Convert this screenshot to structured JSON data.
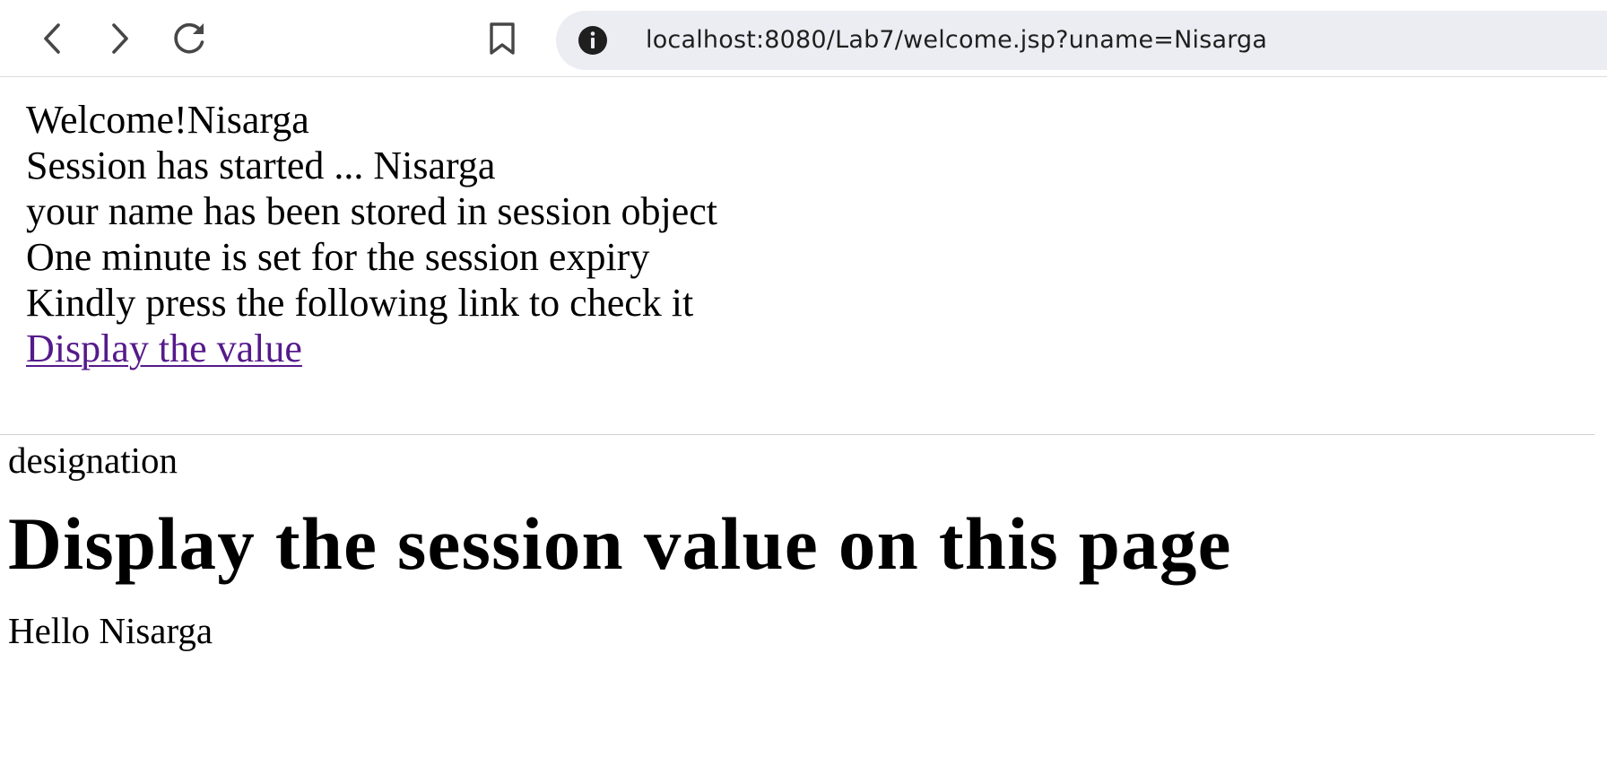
{
  "browser": {
    "url": "localhost:8080/Lab7/welcome.jsp?uname=Nisarga",
    "icons": {
      "back": "chevron-left-icon",
      "forward": "chevron-right-icon",
      "reload": "reload-icon",
      "bookmark": "bookmark-icon",
      "site_info": "info-icon"
    }
  },
  "welcome_frame": {
    "lines": [
      "Welcome!Nisarga",
      "Session has started ... Nisarga",
      "your name has been stored in session object",
      "One minute is set for the session expiry",
      "Kindly press the following link to check it"
    ],
    "link_label": "Display the value",
    "link_color": "#551a8b"
  },
  "display_frame": {
    "label": "designation",
    "heading": "Display the session value on this page",
    "greeting": "Hello Nisarga"
  }
}
